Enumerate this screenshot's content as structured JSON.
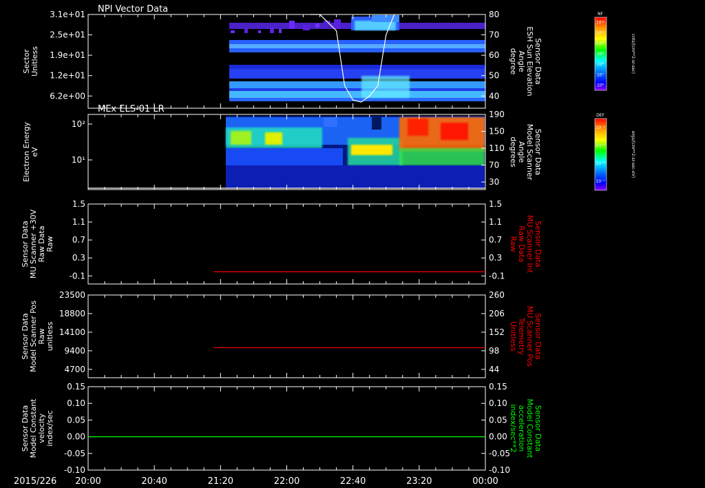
{
  "time_axis": {
    "date": "2015/226",
    "ticks": [
      "20:00",
      "20:40",
      "21:20",
      "22:00",
      "22:40",
      "23:20",
      "00:00"
    ]
  },
  "colors": {
    "background": "#000000",
    "axis": "#ffffff",
    "red_trace": "#ff0000",
    "green_trace": "#00ff00"
  },
  "chart_data": [
    {
      "type": "heatmap",
      "title": "NPI Vector Data",
      "ylabel_lines": [
        "Sector",
        "Unitless"
      ],
      "yticks": [
        "3.1e+01",
        "2.5e+01",
        "1.9e+01",
        "1.2e+01",
        "6.2e+00"
      ],
      "y2label_lines": [
        "Sensor Data",
        "ESH Sun Elevation",
        "Angle",
        "degree"
      ],
      "y2ticks": [
        "80",
        "70",
        "60",
        "50",
        "40"
      ],
      "colorbar": {
        "label": "NF",
        "unit": "cnts/(cm**2-sr-sec)",
        "ticks": [
          "10¹²",
          "10¹¹",
          "10¹⁰",
          "10⁹",
          "10⁸",
          "10⁷",
          "10⁶"
        ]
      },
      "data_start": "21:20",
      "overlay_line": {
        "name": "ESH Sun Elevation Angle",
        "x": [
          "22:20",
          "22:30",
          "22:35",
          "22:40",
          "22:45",
          "22:50",
          "22:55",
          "23:00",
          "23:05"
        ],
        "y": [
          80,
          72,
          45,
          38,
          37,
          40,
          45,
          70,
          80
        ]
      }
    },
    {
      "type": "heatmap",
      "title": "MEx ELS-01 LR",
      "ylabel_lines": [
        "Electron Energy",
        "eV"
      ],
      "yticks": [
        "10²",
        "10¹"
      ],
      "y2label_lines": [
        "Sensor Data",
        "Model Scanner",
        "Angle",
        "degrees"
      ],
      "y2ticks": [
        "190",
        "150",
        "110",
        "70",
        "30"
      ],
      "colorbar": {
        "label": "DEF",
        "unit": "ergs/(cm**2-sr-sec-eV)",
        "ticks": [
          "10⁻⁴",
          "10⁻⁵",
          "10⁻⁶",
          "10⁻⁷"
        ]
      },
      "data_start": "21:20",
      "overlay_line": {
        "name": "Model Scanner Angle",
        "x": [
          "20:00",
          "00:00"
        ],
        "y": [
          10,
          10
        ]
      }
    },
    {
      "type": "line",
      "ylabel_lines": [
        "Sensor Data",
        "MU Scanner +30V",
        "Raw Data",
        "Raw"
      ],
      "yticks": [
        "1.5",
        "1.1",
        "0.7",
        "0.3",
        "-0.1"
      ],
      "ylim": [
        -0.4,
        1.5
      ],
      "y2label_lines": [
        "Sensor Data",
        "MU Scanner Int",
        "Raw Data",
        "Raw"
      ],
      "y2ticks": [
        "1.5",
        "1.1",
        "0.7",
        "0.3",
        "-0.1"
      ],
      "y2_color": "#ff0000",
      "series": [
        {
          "x": [
            "21:20",
            "00:00"
          ],
          "y": [
            0.0,
            0.0
          ],
          "color": "#ff0000"
        }
      ]
    },
    {
      "type": "line",
      "ylabel_lines": [
        "Sensor Data",
        "Model Scanner Pos",
        "Raw",
        "unitless"
      ],
      "yticks": [
        "23500",
        "18800",
        "14100",
        "9400",
        "4700"
      ],
      "ylim": [
        0,
        23500
      ],
      "y2label_lines": [
        "Sensor Data",
        "MU Scanner Pos",
        "Telemetry",
        "Unitless"
      ],
      "y2ticks": [
        "260",
        "206",
        "152",
        "98",
        "44"
      ],
      "y2lim": [
        0,
        260
      ],
      "y2_color": "#ff0000",
      "series": [
        {
          "axis": "y2",
          "x": [
            "21:20",
            "00:00"
          ],
          "y": [
            90,
            90
          ],
          "color": "#ff0000"
        }
      ]
    },
    {
      "type": "line",
      "ylabel_lines": [
        "Sensor Data",
        "Model Constant",
        "velocity",
        "index/sec"
      ],
      "yticks": [
        "0.15",
        "0.10",
        "0.05",
        "0.00",
        "-0.05",
        "-0.10"
      ],
      "ylim": [
        -0.1,
        0.15
      ],
      "y2label_lines": [
        "Sensor Data",
        "Model Constant",
        "acceleration",
        "index/sec**2"
      ],
      "y2ticks": [
        "0.15",
        "0.10",
        "0.05",
        "0.00",
        "-0.05",
        "-0.10"
      ],
      "y2_color": "#00ff00",
      "series": [
        {
          "x": [
            "20:00",
            "00:00"
          ],
          "y": [
            0.0,
            0.0
          ],
          "color": "#00ff00"
        }
      ]
    }
  ]
}
